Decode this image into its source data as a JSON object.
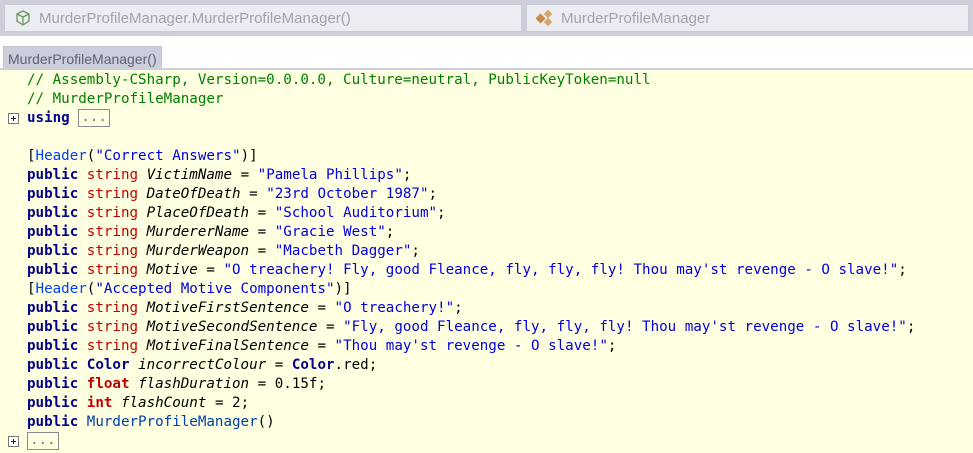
{
  "header": {
    "member_dropdown": "MurderProfileManager.MurderProfileManager()",
    "member_icon": "cube-icon",
    "type_dropdown": "MurderProfileManager",
    "type_icon": "class-icon"
  },
  "tab": {
    "label": "MurderProfileManager()"
  },
  "code": {
    "comment1": "// Assembly-CSharp, Version=0.0.0.0, Culture=neutral, PublicKeyToken=null",
    "comment2": "// MurderProfileManager",
    "using_kw": "using",
    "collapsed_text": "...",
    "kw_public": "public",
    "kw_string": "string",
    "header1": {
      "attr": "Header",
      "arg": "\"Correct Answers\""
    },
    "header2": {
      "attr": "Header",
      "arg": "\"Accepted Motive Components\""
    },
    "fields": [
      {
        "name": "VictimName",
        "value": "\"Pamela Phillips\""
      },
      {
        "name": "DateOfDeath",
        "value": "\"23rd October 1987\""
      },
      {
        "name": "PlaceOfDeath",
        "value": "\"School Auditorium\""
      },
      {
        "name": "MurdererName",
        "value": "\"Gracie West\""
      },
      {
        "name": "MurderWeapon",
        "value": "\"Macbeth Dagger\""
      },
      {
        "name": "Motive",
        "value": "\"O treachery! Fly, good Fleance, fly, fly, fly! Thou may'st revenge - O slave!\""
      }
    ],
    "motive_fields": [
      {
        "name": "MotiveFirstSentence",
        "value": "\"O treachery!\""
      },
      {
        "name": "MotiveSecondSentence",
        "value": "\"Fly, good Fleance, fly, fly, fly! Thou may'st revenge - O slave!\""
      },
      {
        "name": "MotiveFinalSentence",
        "value": "\"Thou may'st revenge - O slave!\""
      }
    ],
    "color_line": {
      "type": "Color",
      "name": "incorrectColour",
      "rhs_type": "Color",
      "rhs_member": ".red"
    },
    "float_line": {
      "type": "float",
      "name": "flashDuration",
      "value": "0.15f"
    },
    "int_line": {
      "type": "int",
      "name": "flashCount",
      "value": "2"
    },
    "ctor_line": {
      "name": "MurderProfileManager",
      "parens": "()"
    }
  },
  "colors": {
    "comment": "#008000",
    "keyword": "#00008b",
    "type": "#c00000",
    "string": "#0000e0",
    "editor_bg": "#ffffe1"
  }
}
